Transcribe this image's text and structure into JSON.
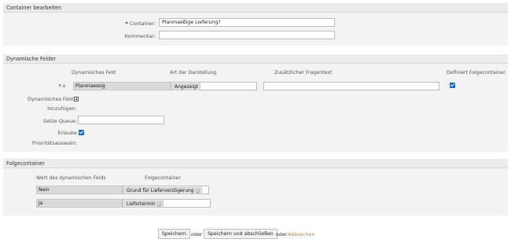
{
  "edit_container": {
    "header": "Container bearbeiten",
    "container_label": "Container:",
    "container_value": "Planmaeßige Lieferung?",
    "comment_label": "Kommentar:",
    "comment_value": ""
  },
  "dynamic_fields": {
    "header": "Dynamische Felder",
    "col_dynamic_field": "Dynamisches Feld",
    "col_display_type": "Art der Darstellung",
    "col_question_text": "Zusätzlicher Fragentext",
    "col_defines_followup": "Definiert Folgecontainer",
    "row_field": "Planmaessig",
    "row_display": "Angezeigt",
    "row_question": "",
    "row_defines_followup": true,
    "add_label_line1": "Dynamisches Feld",
    "add_label_line2": "hinzufügen:",
    "queue_label": "Setze Queue:",
    "queue_value": "",
    "allow_label": "Erlaube",
    "allow_checked": true,
    "priority_label": "Prioritätsauswahl:"
  },
  "followup": {
    "header": "Folgecontainer",
    "col_value": "Wert des dynamischen Felds",
    "col_container": "Folgecontainer",
    "rows": [
      {
        "value": "Nein",
        "container": "Grund für Lieferverzögerung"
      },
      {
        "value": "Ja",
        "container": "Liefertermin"
      }
    ],
    "remove_glyph": "x"
  },
  "actions": {
    "save": "Speichern",
    "or1": "oder",
    "save_close": "Speichern und abschließen",
    "or2": "oder",
    "cancel": "Abbrechen"
  }
}
